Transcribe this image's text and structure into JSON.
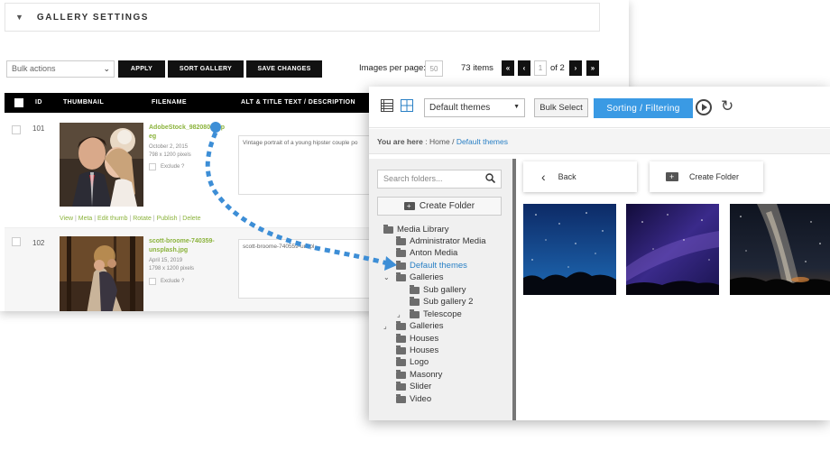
{
  "back_panel": {
    "section_title": "GALLERY SETTINGS",
    "bulk_placeholder": "Bulk actions",
    "buttons": [
      "APPLY",
      "SORT GALLERY",
      "SAVE CHANGES"
    ],
    "images_per_page_label": "Images per page:",
    "images_per_page_value": "50",
    "items_count": "73 items",
    "page_current": "1",
    "page_of": "of 2",
    "pager": {
      "first": "«",
      "prev": "‹",
      "next": "›",
      "last": "»"
    },
    "columns": [
      "ID",
      "THUMBNAIL",
      "FILENAME",
      "ALT & TITLE TEXT / DESCRIPTION"
    ],
    "rows": [
      {
        "id": "101",
        "filename_line1": "AdobeStock_98208059.jp",
        "filename_line2": "eg",
        "date": "October 2, 2015",
        "size": "798 x 1200 pixels",
        "exclude": "Exclude ?",
        "description": "Vintage portrait of a young hipster couple po",
        "actions": [
          "View",
          "Meta",
          "Edit thumb",
          "Rotate",
          "Publish",
          "Delete"
        ]
      },
      {
        "id": "102",
        "filename_line1": "scott-broome-740359-",
        "filename_line2": "unsplash.jpg",
        "date": "April 15, 2019",
        "size": "1798 x 1200 pixels",
        "exclude": "Exclude ?",
        "description": "scott-broome-740559-unspl"
      }
    ]
  },
  "front_panel": {
    "theme_select": "Default themes",
    "bulk_select": "Bulk Select",
    "sorting_filtering": "Sorting / Filtering",
    "breadcrumb": {
      "prefix": "You are here",
      "sep": ":",
      "home": "Home",
      "slash": "/",
      "current": "Default themes"
    },
    "search_placeholder": "Search folders...",
    "create_folder_tree": "Create Folder",
    "tree": [
      "Media Library",
      "Administrator Media",
      "Anton Media",
      "Default themes",
      "Galleries",
      "Sub gallery",
      "Sub gallery 2",
      "Telescope",
      "Galleries",
      "Houses",
      "Houses",
      "Logo",
      "Masonry",
      "Slider",
      "Video"
    ],
    "back_button": "Back",
    "create_folder_main": "Create Folder"
  },
  "colors": {
    "accent": "#3a9ae4",
    "link_green": "#8bb33c",
    "link_blue": "#2a80c5",
    "drag_arrow": "#3d8ed6"
  },
  "icons": [
    "list-view-icon",
    "grid-view-icon",
    "play-icon",
    "refresh-icon",
    "search-icon",
    "folder-plus-icon",
    "chevron-left-icon",
    "folder-icon"
  ]
}
